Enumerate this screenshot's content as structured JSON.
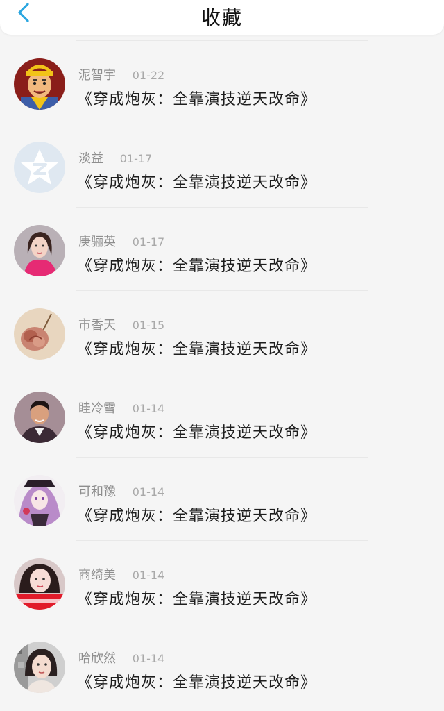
{
  "header": {
    "title": "收藏",
    "back_icon": "chevron-left-icon",
    "accent": "#2aa6e0"
  },
  "items": [
    {
      "name": "泥智宇",
      "date": "01-22",
      "book": "《穿成炮灰：全靠演技逆天改命》",
      "avatar": "avatar-cartoon-man"
    },
    {
      "name": "淡益",
      "date": "01-17",
      "book": "《穿成炮灰：全靠演技逆天改命》",
      "avatar": "avatar-qzone-default"
    },
    {
      "name": "庚骊英",
      "date": "01-17",
      "book": "《穿成炮灰：全靠演技逆天改命》",
      "avatar": "avatar-woman-pink"
    },
    {
      "name": "市香天",
      "date": "01-15",
      "book": "《穿成炮灰：全靠演技逆天改命》",
      "avatar": "avatar-rose"
    },
    {
      "name": "眭冷雪",
      "date": "01-14",
      "book": "《穿成炮灰：全靠演技逆天改命》",
      "avatar": "avatar-man-suit"
    },
    {
      "name": "可和豫",
      "date": "01-14",
      "book": "《穿成炮灰：全靠演技逆天改命》",
      "avatar": "avatar-anime-girl"
    },
    {
      "name": "商绮美",
      "date": "01-14",
      "book": "《穿成炮灰：全靠演技逆天改命》",
      "avatar": "avatar-girl-selfie"
    },
    {
      "name": "哈欣然",
      "date": "01-14",
      "book": "《穿成炮灰：全靠演技逆天改命》",
      "avatar": "avatar-girl-portrait"
    }
  ]
}
